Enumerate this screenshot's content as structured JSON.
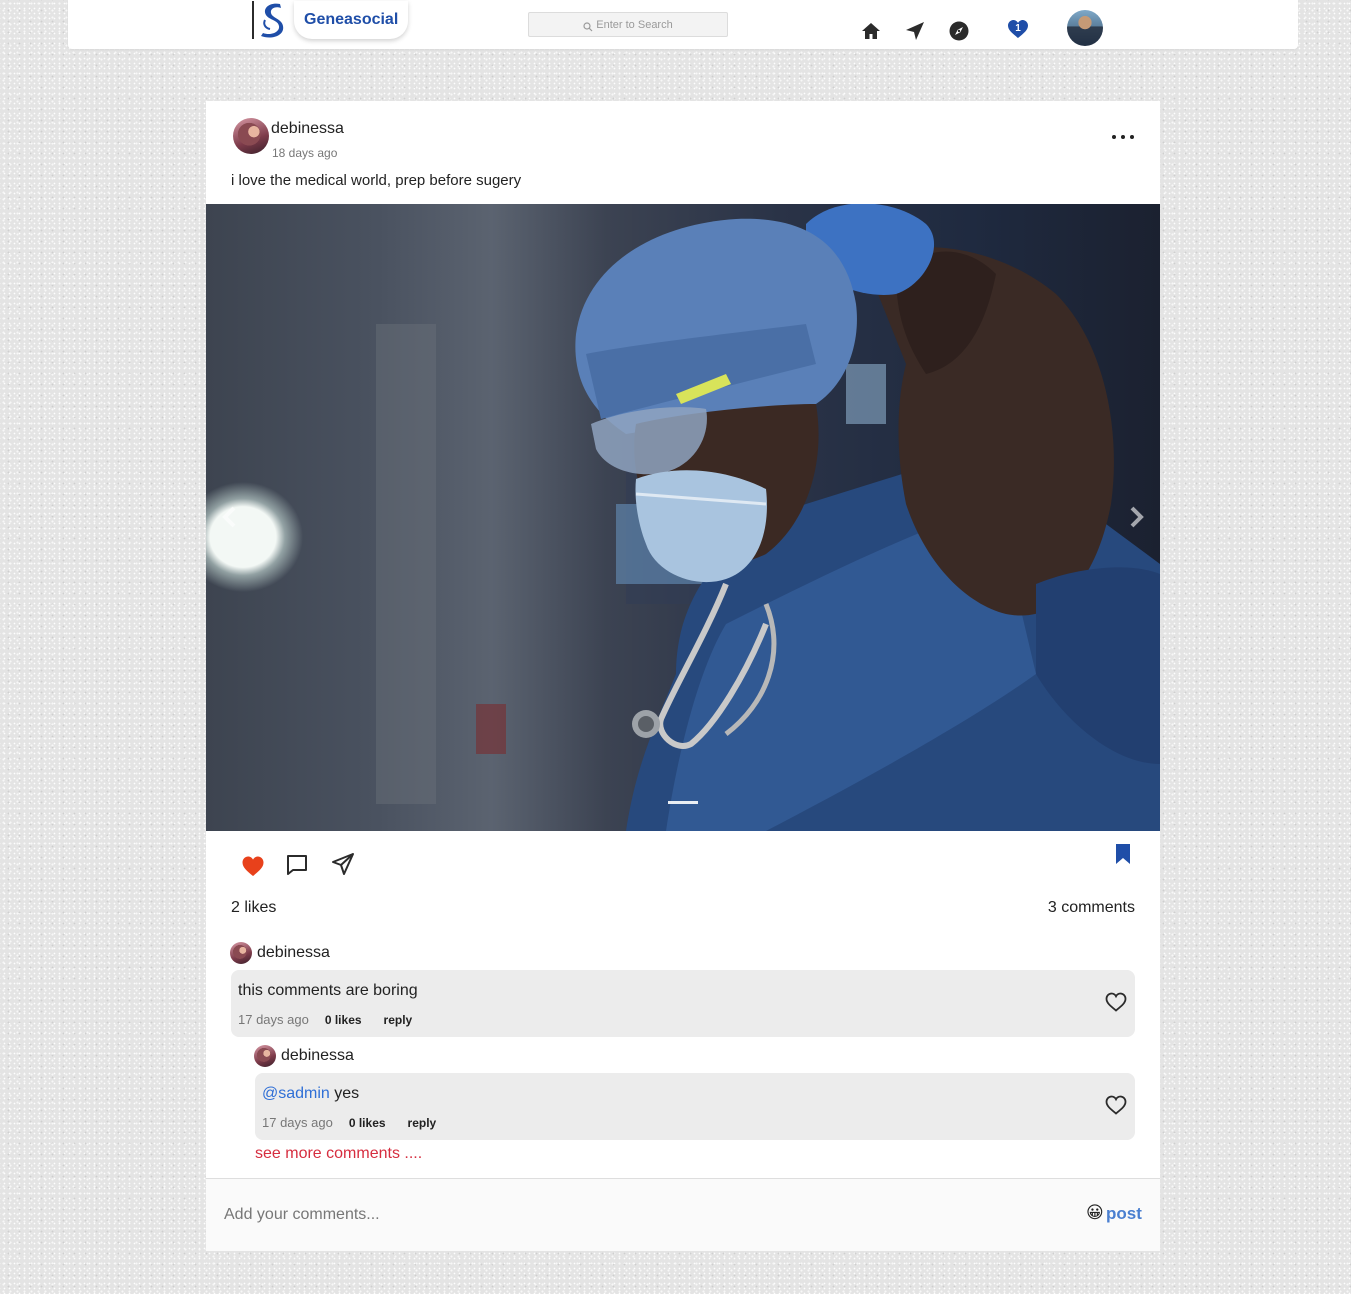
{
  "header": {
    "brand_name": "Geneasocial",
    "search_placeholder": "Enter to Search",
    "notification_count": "1",
    "icons": [
      "home-icon",
      "send-icon",
      "compass-icon",
      "heart-icon"
    ]
  },
  "post": {
    "author": "debinessa",
    "time": "18 days ago",
    "caption": "i love the medical world, prep before sugery",
    "likes": "2 likes",
    "comments_count": "3 comments",
    "liked": true,
    "saved": true
  },
  "comments": [
    {
      "author": "debinessa",
      "text": "this comments are boring",
      "time": "17 days ago",
      "likes": "0 likes",
      "reply_label": "reply"
    },
    {
      "author": "debinessa",
      "mention": "@sadmin",
      "text": "yes",
      "time": "17 days ago",
      "likes": "0 likes",
      "reply_label": "reply"
    }
  ],
  "see_more": "see more comments ....",
  "composer": {
    "placeholder": "Add your comments...",
    "emoji": "😀",
    "post_label": "post"
  },
  "colors": {
    "brand": "#1f4ea8",
    "like_active": "#e8411b",
    "save_active": "#1f4ea8",
    "mention": "#2f6fd6",
    "see_more": "#d62d3f",
    "post_button": "#4a7fd0"
  }
}
